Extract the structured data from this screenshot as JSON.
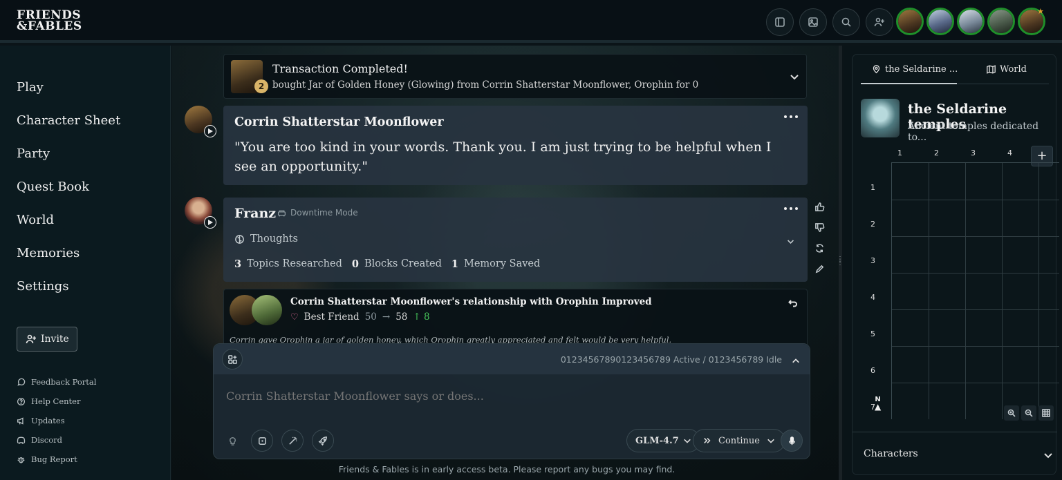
{
  "logo": {
    "line1": "FRIENDS",
    "line2": "&FABLES"
  },
  "topbar": {
    "icons": [
      "sidebar-icon",
      "image-icon",
      "search-icon",
      "add-user-icon"
    ],
    "party_avatars": 5
  },
  "sidebar": {
    "nav": [
      "Play",
      "Character Sheet",
      "Party",
      "Quest Book",
      "World",
      "Memories",
      "Settings"
    ],
    "invite_label": "Invite",
    "footer_links": [
      "Feedback Portal",
      "Help Center",
      "Updates",
      "Discord",
      "Bug Report"
    ]
  },
  "transaction": {
    "title": "Transaction Completed!",
    "quantity": "2",
    "detail": "bought Jar of Golden Honey (Glowing) from Corrin Shatterstar Moonflower, Orophin for 0"
  },
  "message1": {
    "speaker": "Corrin Shatterstar Moonflower",
    "text": "\"You are too kind in your words. Thank you. I am just trying to be helpful when I see an opportunity.\""
  },
  "message2": {
    "speaker": "Franz",
    "mode": "Downtime Mode",
    "thoughts_label": "Thoughts",
    "stat1_value": "3",
    "stat1_label": "Topics Researched",
    "stat2_value": "0",
    "stat2_label": "Blocks Created",
    "stat3_value": "1",
    "stat3_label": "Memory Saved"
  },
  "relationship": {
    "title": "Corrin Shatterstar Moonflower's relationship with Orophin Improved",
    "level": "Best Friend",
    "from": "50",
    "arrow": "→",
    "to": "58",
    "delta": "↑ 8",
    "description": "Corrin gave Orophin a jar of golden honey, which Orophin greatly appreciated and felt would be very helpful."
  },
  "composer": {
    "status": "01234567890123456789 Active / 0123456789 Idle",
    "placeholder": "Corrin Shatterstar Moonflower says or does...",
    "model": "GLM-4.7",
    "continue_label": "Continue"
  },
  "beta_note": "Friends & Fables is in early access beta. Please report any bugs you may find.",
  "right_panel": {
    "tab_location": "the Seldarine ...",
    "tab_world": "World",
    "location_title": "the Seldarine temples",
    "location_sub": "Ancient temples dedicated to...",
    "columns": [
      "1",
      "2",
      "3",
      "4"
    ],
    "rows": [
      "1",
      "2",
      "3",
      "4",
      "5",
      "6",
      "7"
    ],
    "compass": "N",
    "characters_label": "Characters"
  },
  "colors": {
    "accent_green": "#1f8f2a",
    "up_green": "#46c35a",
    "heart": "#e06a9a",
    "badge_gold": "#d9b468"
  }
}
